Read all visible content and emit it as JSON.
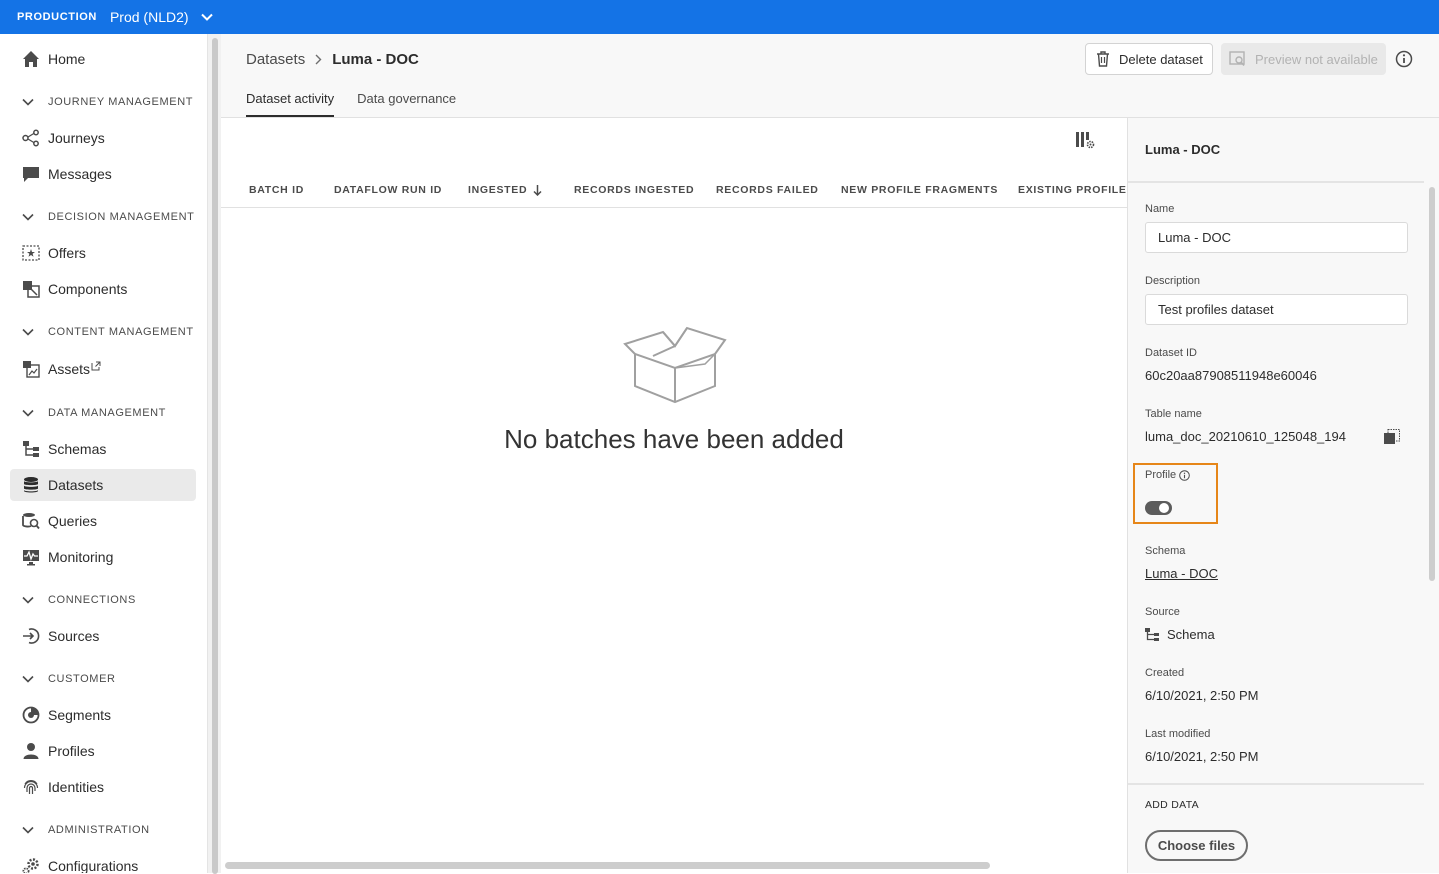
{
  "topbar": {
    "environment": "PRODUCTION",
    "sandbox": "Prod (NLD2)"
  },
  "sidebar": {
    "items": [
      {
        "label": "Home"
      },
      {
        "label": "JOURNEY MANAGEMENT"
      },
      {
        "label": "Journeys"
      },
      {
        "label": "Messages"
      },
      {
        "label": "DECISION MANAGEMENT"
      },
      {
        "label": "Offers"
      },
      {
        "label": "Components"
      },
      {
        "label": "CONTENT MANAGEMENT"
      },
      {
        "label": "Assets"
      },
      {
        "label": "DATA MANAGEMENT"
      },
      {
        "label": "Schemas"
      },
      {
        "label": "Datasets"
      },
      {
        "label": "Queries"
      },
      {
        "label": "Monitoring"
      },
      {
        "label": "CONNECTIONS"
      },
      {
        "label": "Sources"
      },
      {
        "label": "CUSTOMER"
      },
      {
        "label": "Segments"
      },
      {
        "label": "Profiles"
      },
      {
        "label": "Identities"
      },
      {
        "label": "ADMINISTRATION"
      },
      {
        "label": "Configurations"
      }
    ]
  },
  "breadcrumb": {
    "parent": "Datasets",
    "current": "Luma - DOC"
  },
  "toolbar": {
    "delete_label": "Delete dataset",
    "preview_label": "Preview not available"
  },
  "tabs": [
    {
      "label": "Dataset activity"
    },
    {
      "label": "Data governance"
    }
  ],
  "table": {
    "columns": [
      "BATCH ID",
      "DATAFLOW RUN ID",
      "INGESTED",
      "RECORDS INGESTED",
      "RECORDS FAILED",
      "NEW PROFILE FRAGMENTS",
      "EXISTING PROFILE FI"
    ],
    "empty_message": "No batches have been added"
  },
  "panel": {
    "title": "Luma - DOC",
    "name_label": "Name",
    "name_value": "Luma - DOC",
    "description_label": "Description",
    "description_value": "Test profiles dataset",
    "dataset_id_label": "Dataset ID",
    "dataset_id_value": "60c20aa87908511948e60046",
    "table_name_label": "Table name",
    "table_name_value": "luma_doc_20210610_125048_194",
    "profile_label": "Profile",
    "profile_enabled": true,
    "schema_label": "Schema",
    "schema_value": "Luma - DOC",
    "source_label": "Source",
    "source_value": "Schema",
    "created_label": "Created",
    "created_value": "6/10/2021, 2:50 PM",
    "modified_label": "Last modified",
    "modified_value": "6/10/2021, 2:50 PM",
    "add_data_label": "ADD DATA",
    "choose_files_label": "Choose files"
  },
  "colors": {
    "topbar": "#1473e6",
    "highlight": "#e68619"
  }
}
